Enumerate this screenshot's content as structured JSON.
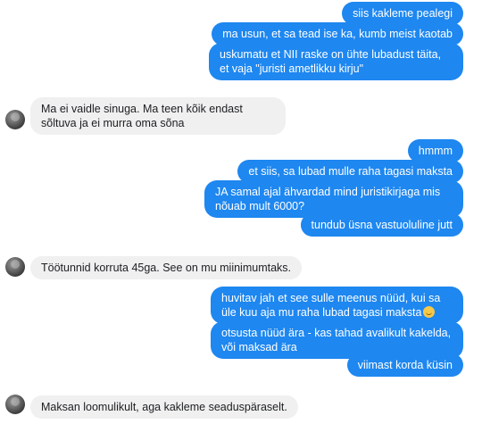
{
  "messages": [
    {
      "side": "out",
      "text": "siis kakleme pealegi"
    },
    {
      "side": "out",
      "text": "ma usun, et sa tead ise ka, kumb meist kaotab"
    },
    {
      "side": "out",
      "text": "uskumatu et NII raske on ühte lubadust täita, et vaja \"juristi ametlikku kirju\""
    },
    {
      "side": "in",
      "text": "Ma ei vaidle sinuga. Ma teen kõik endast sõltuva ja ei murra oma sõna"
    },
    {
      "side": "out",
      "text": "hmmm"
    },
    {
      "side": "out",
      "text": "et siis, sa lubad mulle raha tagasi maksta"
    },
    {
      "side": "out",
      "text": "JA samal ajal ähvardad mind juristikirjaga mis nõuab mult 6000?"
    },
    {
      "side": "out",
      "text": "tundub üsna vastuoluline jutt"
    },
    {
      "side": "in",
      "text": "Töötunnid korruta 45ga. See on mu miinimumtaks."
    },
    {
      "side": "out",
      "text": "huvitav jah et see sulle meenus nüüd, kui sa üle kuu aja mu raha lubad tagasi maksta",
      "emoji": "smiling-face-emoji"
    },
    {
      "side": "out",
      "text": "otsusta nüüd ära - kas tahad avalikult kakelda, või maksad ära"
    },
    {
      "side": "out",
      "text": "viimast korda küsin"
    },
    {
      "side": "in",
      "text": "Maksan loomulikult, aga kakleme seaduspäraselt."
    }
  ],
  "avatar_icon": "user-avatar",
  "colors": {
    "outgoing": "#1e87f0",
    "incoming": "#f0f0f0",
    "background": "#ffffff"
  }
}
